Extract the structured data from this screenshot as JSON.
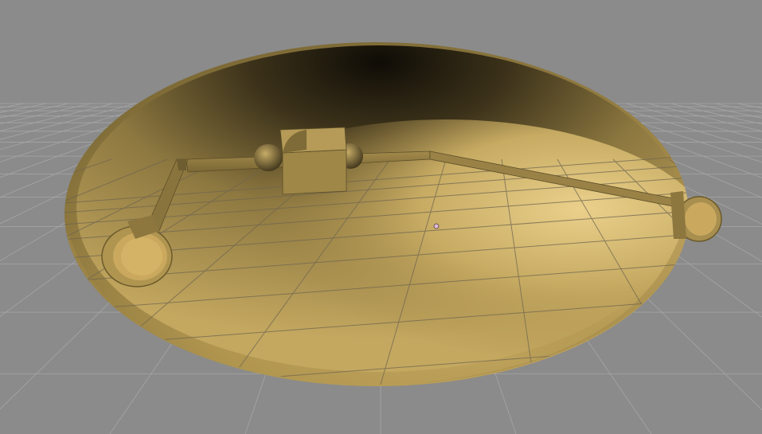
{
  "viewport": {
    "background_color": "#8b8b8b",
    "grid_color": "#a6a6a6",
    "model_color": "#b59a55",
    "model_shadow_color": "#1c160a",
    "pivot_color": "#e6b8d6"
  },
  "scene": {
    "objects": [
      {
        "name": "bowl",
        "icon": "dish-shape"
      },
      {
        "name": "rail",
        "icon": "bar-shape"
      },
      {
        "name": "block",
        "icon": "cube-shape"
      },
      {
        "name": "left-ring",
        "icon": "ring-shape"
      },
      {
        "name": "right-ring",
        "icon": "ring-shape"
      },
      {
        "name": "small-spheres",
        "icon": "sphere-shape"
      }
    ]
  }
}
